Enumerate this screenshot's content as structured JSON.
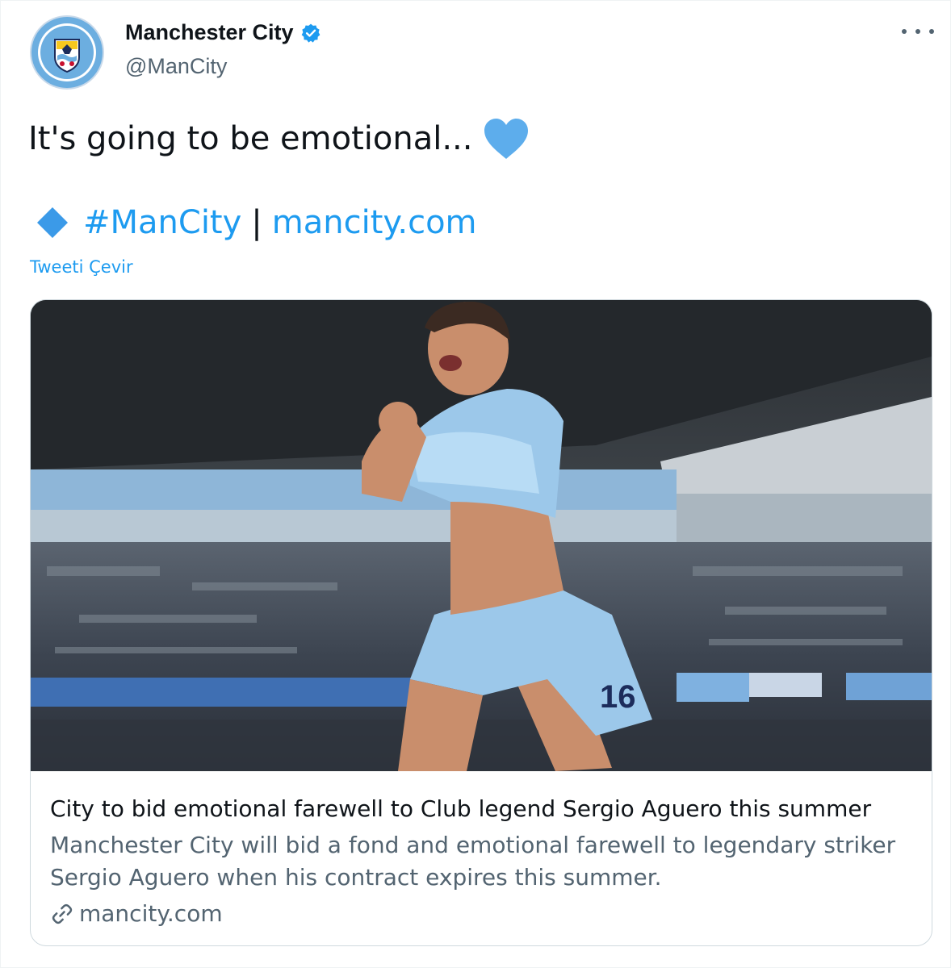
{
  "tweet": {
    "author_name": "Manchester City",
    "author_handle": "@ManCity",
    "text": "It's going to be emotional...",
    "hashtag": "#ManCity",
    "separator": "|",
    "link_text": "mancity.com",
    "translate_label": "Tweeti Çevir"
  },
  "card": {
    "title": "City to bid emotional farewell to Club legend Sergio Aguero this summer",
    "description": "Manchester City will bid a fond and emotional farewell to legendary striker Sergio Aguero when his contract expires this summer.",
    "domain": "mancity.com",
    "photo_shirt_number": "16"
  },
  "icons": {
    "verified": "verified-badge-icon",
    "more": "more-options-icon",
    "heart": "blue-heart-emoji",
    "diamond": "blue-diamond-emoji",
    "link": "link-icon"
  },
  "colors": {
    "accent": "#1d9bf0",
    "text": "#0f1419",
    "secondary": "#536471",
    "heart": "#5dadec",
    "city_blue": "#98c5e9"
  }
}
